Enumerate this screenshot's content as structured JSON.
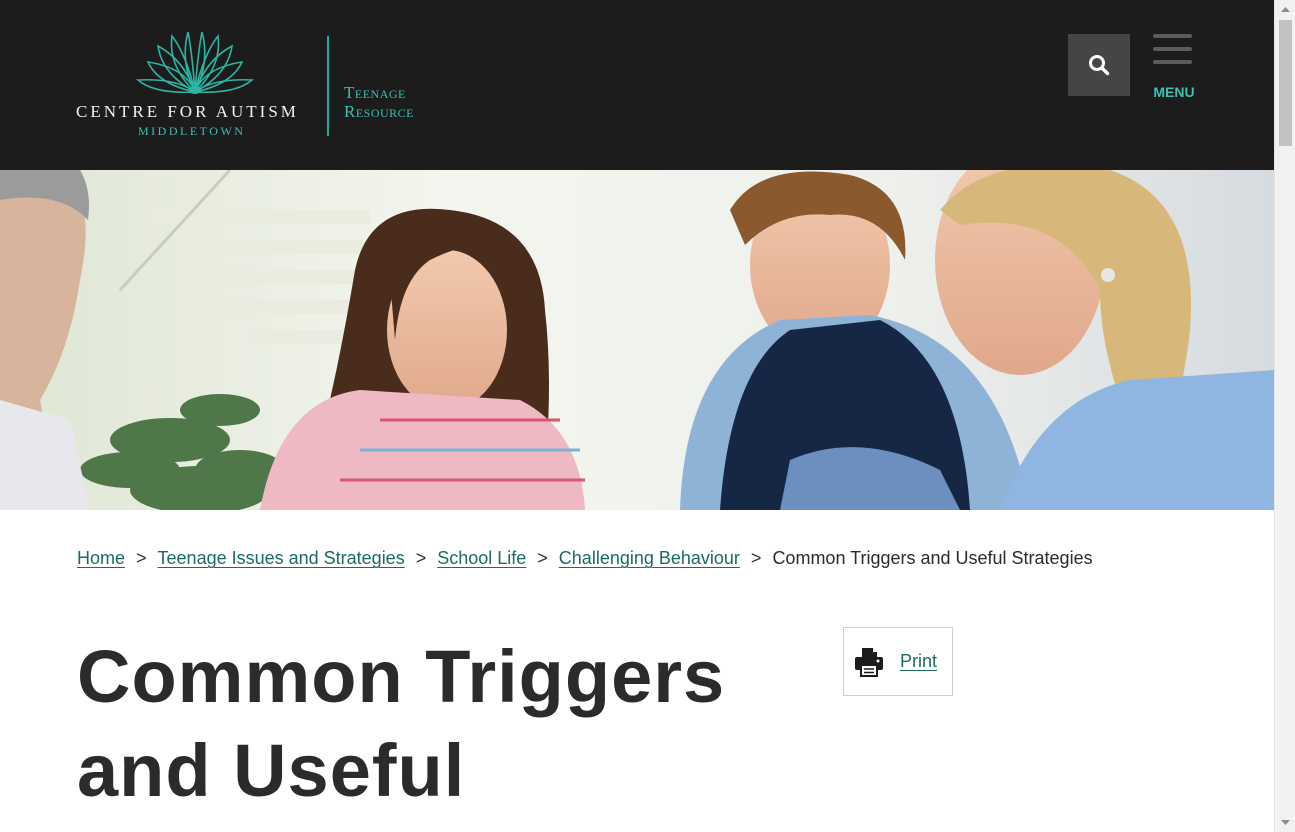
{
  "header": {
    "logo": {
      "name": "CENTRE FOR AUTISM",
      "place": "MIDDLETOWN",
      "section_line1": "Teenage",
      "section_line2": "Resource"
    },
    "search_icon": "search-icon",
    "menu": {
      "label": "MENU",
      "icon": "hamburger-icon"
    }
  },
  "hero": {
    "image": "teenagers-and-adults-conversation-photo"
  },
  "breadcrumb": {
    "separator": ">",
    "items": [
      {
        "label": "Home",
        "link": true
      },
      {
        "label": "Teenage Issues and Strategies",
        "link": true
      },
      {
        "label": "School Life",
        "link": true
      },
      {
        "label": "Challenging Behaviour",
        "link": true
      },
      {
        "label": "Common Triggers and Useful Strategies",
        "link": false
      }
    ]
  },
  "page": {
    "title_line1": "Common Triggers",
    "title_line2": "and Useful"
  },
  "print": {
    "label": "Print",
    "icon": "printer-icon"
  },
  "colors": {
    "header_bg": "#1c1c1c",
    "accent": "#3cc0b0",
    "link": "#1c6b63"
  }
}
